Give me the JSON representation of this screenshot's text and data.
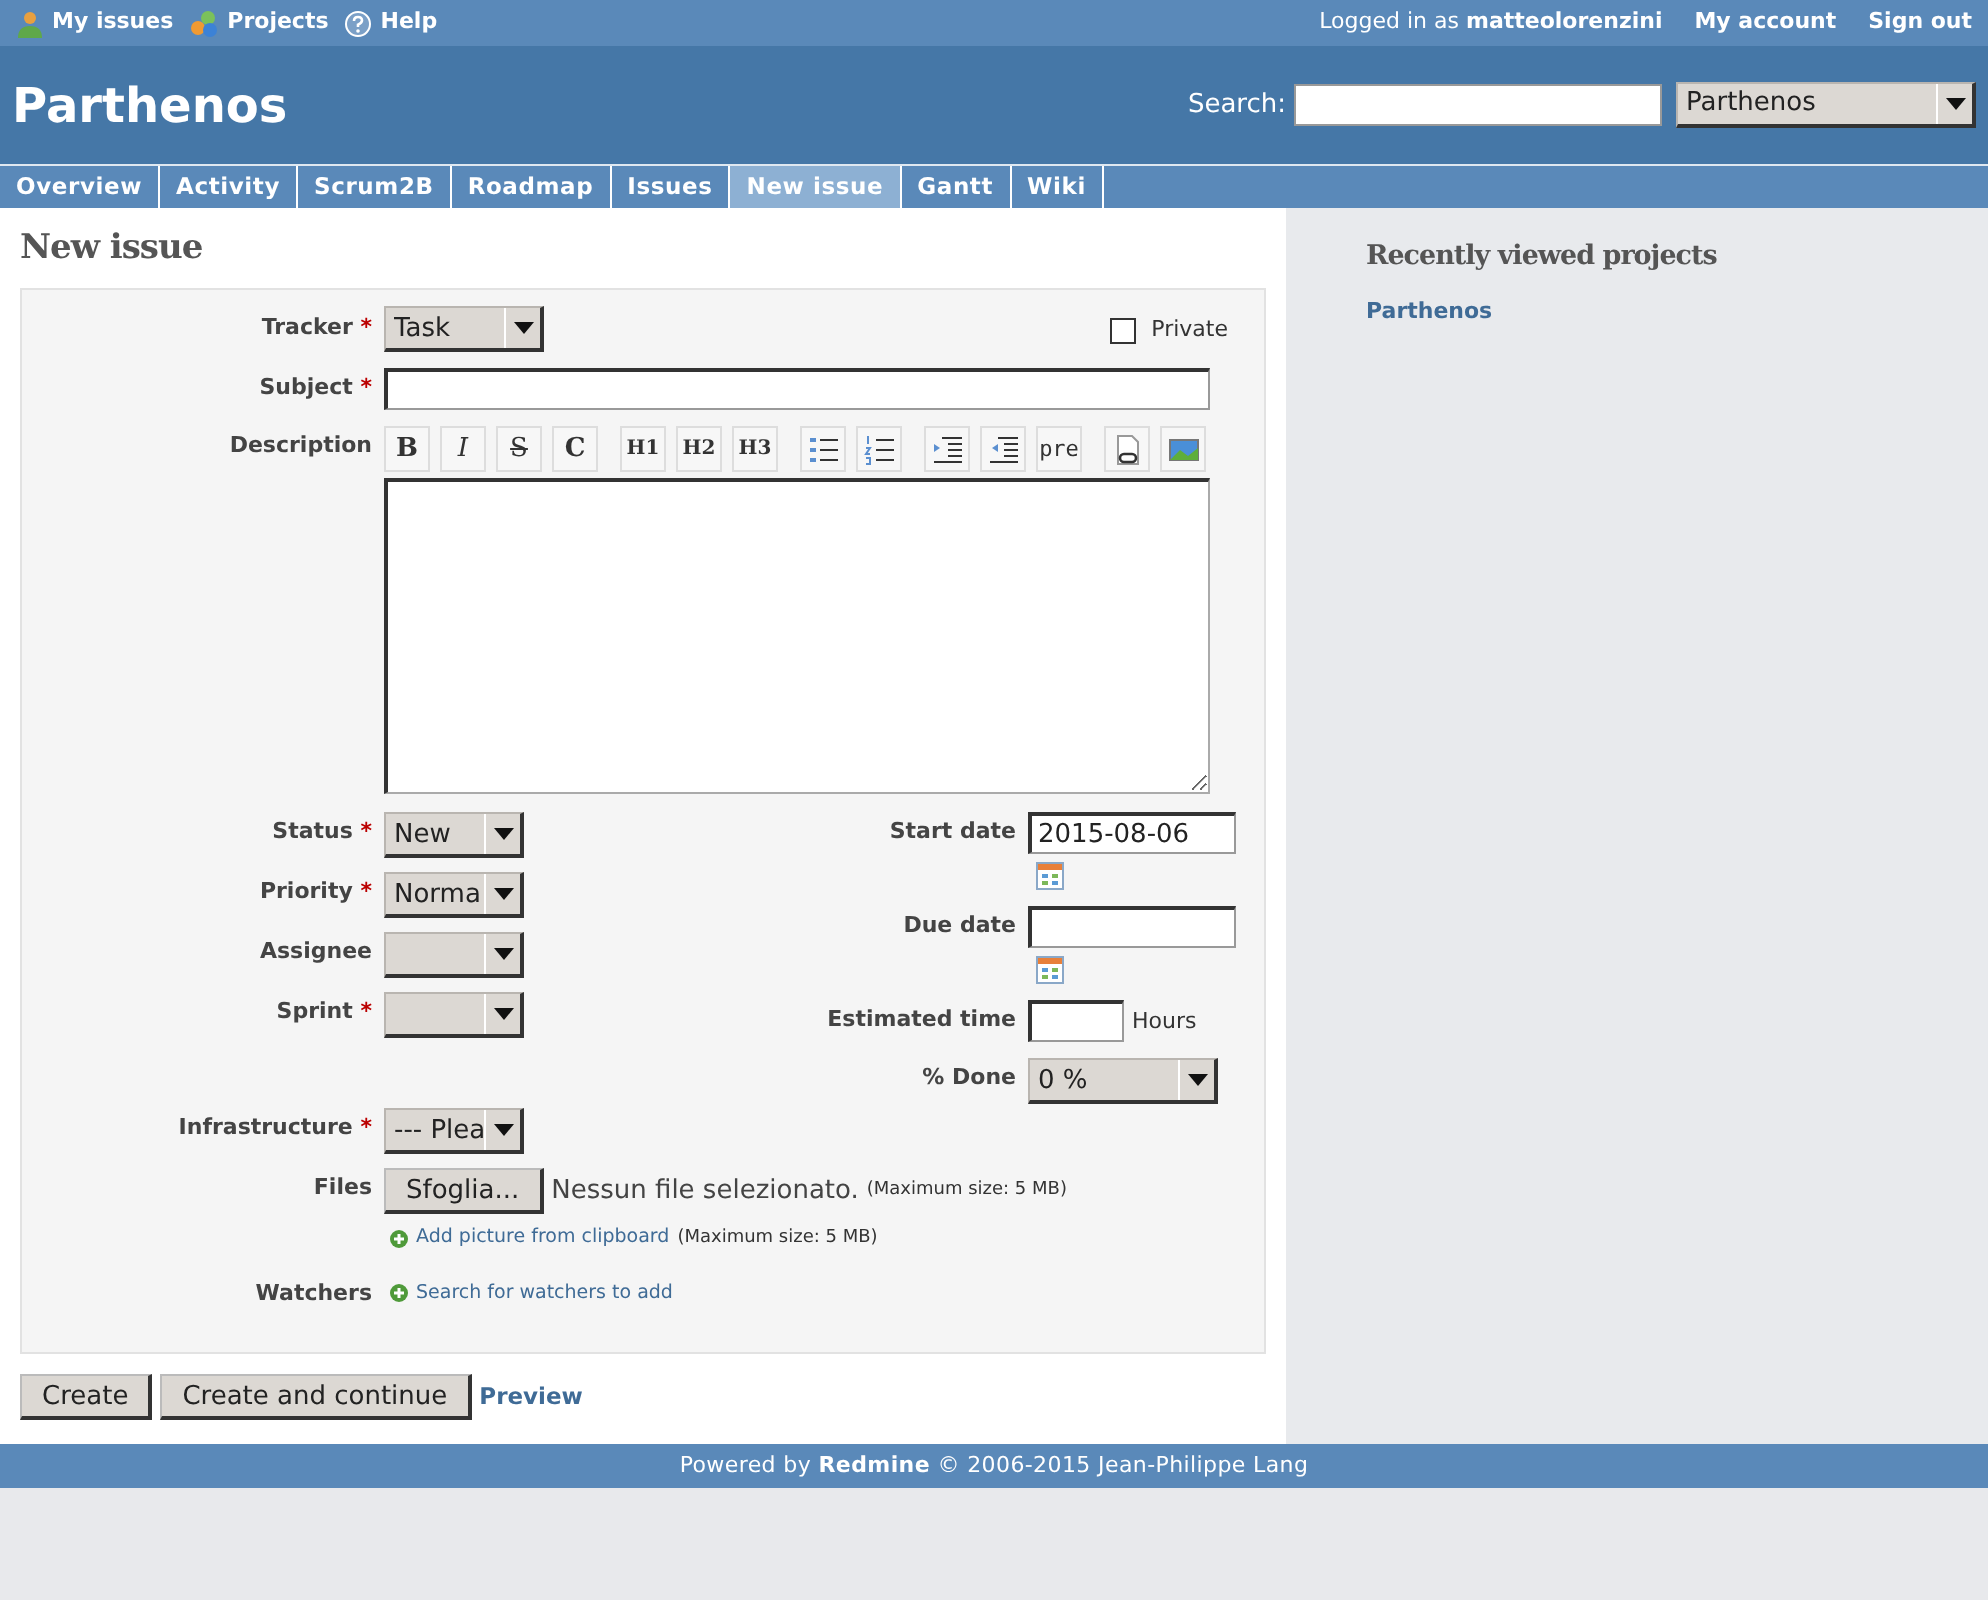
{
  "top_menu": [
    {
      "kind": "user",
      "label": "My issues"
    },
    {
      "kind": "projects",
      "label": "Projects"
    },
    {
      "kind": "help",
      "label": "Help"
    }
  ],
  "account": {
    "prefix": "Logged in as",
    "user": "matteolorenzini",
    "links": [
      "My account",
      "Sign out"
    ]
  },
  "header": {
    "title": "Parthenos",
    "search_label": "Search:",
    "project_select": "Parthenos"
  },
  "tabs": [
    {
      "label": "Overview",
      "selected": false
    },
    {
      "label": "Activity",
      "selected": false
    },
    {
      "label": "Scrum2B",
      "selected": false
    },
    {
      "label": "Roadmap",
      "selected": false
    },
    {
      "label": "Issues",
      "selected": false
    },
    {
      "label": "New issue",
      "selected": true
    },
    {
      "label": "Gantt",
      "selected": false
    },
    {
      "label": "Wiki",
      "selected": false
    }
  ],
  "page_title": "New issue",
  "tracker": {
    "label": "Tracker",
    "marker": "*",
    "value": "Task"
  },
  "private": {
    "label": "Private",
    "checked": false
  },
  "subject": {
    "label": "Subject",
    "marker": "*"
  },
  "description": {
    "label": "Description",
    "toolbar": [
      {
        "kind": "bold",
        "label": "B"
      },
      {
        "kind": "italic",
        "label": "I"
      },
      {
        "kind": "strike",
        "label": "S"
      },
      {
        "kind": "code",
        "label": "C"
      },
      {
        "kind": "h1",
        "label": "H1"
      },
      {
        "kind": "h2",
        "label": "H2"
      },
      {
        "kind": "h3",
        "label": "H3"
      },
      {
        "kind": "ul"
      },
      {
        "kind": "ol"
      },
      {
        "kind": "indent"
      },
      {
        "kind": "outdent"
      },
      {
        "kind": "pre",
        "label": "pre"
      },
      {
        "kind": "link"
      },
      {
        "kind": "image"
      }
    ]
  },
  "left_fields": [
    {
      "label": "Status",
      "marker": "*",
      "value": "New"
    },
    {
      "label": "Priority",
      "marker": "*",
      "value": "Norma"
    },
    {
      "label": "Assignee"
    },
    {
      "label": "Sprint",
      "marker": "*"
    }
  ],
  "right_fields": [
    {
      "kind": "date",
      "label": "Start date",
      "value": "2015-08-06"
    },
    {
      "kind": "date",
      "label": "Due date"
    },
    {
      "kind": "hours",
      "label": "Estimated time",
      "suffix": "Hours"
    },
    {
      "kind": "select",
      "label": "% Done",
      "value": "0 %"
    }
  ],
  "infrastructure": {
    "label": "Infrastructure",
    "marker": "*",
    "value": "--- Plea"
  },
  "files": {
    "label": "Files",
    "button": "Sfoglia...",
    "status": "Nessun file selezionato.",
    "note": "(Maximum size: 5 MB)",
    "clipboard_link": "Add picture from clipboard",
    "clipboard_note": "(Maximum size: 5 MB)"
  },
  "watchers": {
    "label": "Watchers",
    "link": "Search for watchers to add"
  },
  "buttons": [
    "Create",
    "Create and continue"
  ],
  "preview_link": "Preview",
  "sidebar": {
    "title": "Recently viewed projects",
    "links": [
      "Parthenos"
    ]
  },
  "footer": "Powered by **Redmine** © 2006-2015 Jean-Philippe Lang"
}
